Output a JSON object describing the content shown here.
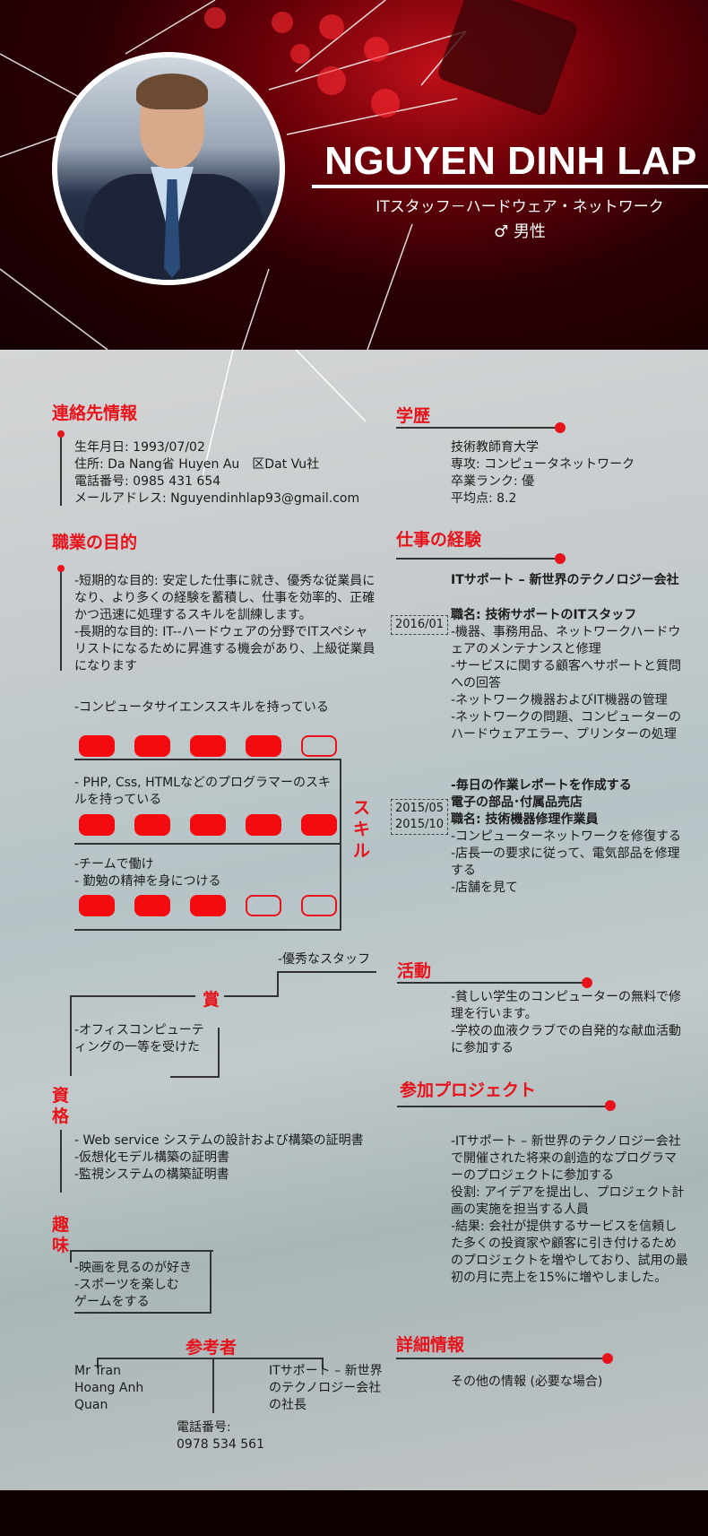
{
  "header": {
    "name": "NGUYEN DINH LAP",
    "job_title": "ITスタッフ－ハードウェア・ネットワーク",
    "gender_icon": "♂",
    "gender": "男性"
  },
  "contact": {
    "heading": "連絡先情報",
    "lines": "生年月日: 1993/07/02\n住所: Da Nang省 Huyen Au　区Dat Vu社\n電話番号: 0985 431 654\nメールアドレス: Nguyendinhlap93@gmail.com"
  },
  "education": {
    "heading": "学歴",
    "lines": "技術教師育大学\n専攻: コンピュータネットワーク\n卒業ランク: 優\n平均点: 8.2"
  },
  "objective": {
    "heading": "職業の目的",
    "text": "-短期的な目的: 安定した仕事に就き、優秀な従業員になり、より多くの経験を蓄積し、仕事を効率的、正確かつ迅速に処理するスキルを訓練します。\n-長期的な目的: IT--ハードウェアの分野でITスペシャリストになるために昇進する機会があり、上級従業員になります"
  },
  "experience": {
    "heading": "仕事の経験",
    "jobs": [
      {
        "date": "2016/01",
        "company": "ITサポート – 新世界のテクノロジー会社",
        "role": "職名: 技術サポートのITスタッフ",
        "details": "-機器、事務用品、ネットワークハードウェアのメンテナンスと修理\n-サービスに関する顧客へサポートと質問への回答\n-ネットワーク機器およびIT機器の管理\n-ネットワークの問題、コンピューターのハードウェアエラー、プリンターの処理",
        "extra": "-毎日の作業レポートを作成する"
      },
      {
        "date": "2015/05\n2015/10",
        "company": "電子の部品･付属品売店",
        "role": "職名: 技術機器修理作業員",
        "details": "-コンピューターネットワークを修復する\n-店長一の要求に従って、電気部品を修理する\n-店舗を見て",
        "extra": ""
      }
    ]
  },
  "skills": {
    "heading": "スキル",
    "items": [
      {
        "label": "-コンピュータサイエンススキルを持っている",
        "level": 4,
        "max": 5
      },
      {
        "label": "- PHP, Css, HTMLなどのプログラマーのスキルを持っている",
        "level": 5,
        "max": 5
      },
      {
        "label": "-チームで働け\n- 勤勉の精神を身につける",
        "level": 3,
        "max": 5
      }
    ]
  },
  "awards": {
    "heading": "賞",
    "item1": "-優秀なスタッフ",
    "item2": "-オフィスコンピューティングの一等を受けた"
  },
  "activities": {
    "heading": "活動",
    "text": "-貧しい学生のコンピューターの無料で修理を行います。\n-学校の血液クラブでの自発的な献血活動に参加する"
  },
  "certificates": {
    "heading": "資格",
    "text": "- Web service システムの設計および構築の証明書\n-仮想化モデル構築の証明書\n-監視システムの構築証明書"
  },
  "projects": {
    "heading": "参加プロジェクト",
    "text": "-ITサポート – 新世界のテクノロジー会社で開催された将来の創造的なプログラマーのプロジェクトに参加する\n役割: アイデアを提出し、プロジェクト計画の実施を担当する人員\n-結果: 会社が提供するサービスを信頼した多くの投資家や顧客に引き付けるためのプロジェクトを増やしており、試用の最初の月に売上を15%に増やしました。"
  },
  "hobbies": {
    "heading": "趣味",
    "text": "-映画を見るのが好き\n-スポーツを楽しむ\nゲームをする"
  },
  "references": {
    "heading": "参考者",
    "name": "Mr Tran\nHoang Anh\nQuan",
    "position": "ITサポート – 新世界のテクノロジー会社の社長",
    "phone": "電話番号:\n0978 534 561"
  },
  "details": {
    "heading": "詳細情報",
    "text": "その他の情報 (必要な場合)"
  },
  "colors": {
    "accent": "#e8121b",
    "header_dark": "#1a0003"
  }
}
